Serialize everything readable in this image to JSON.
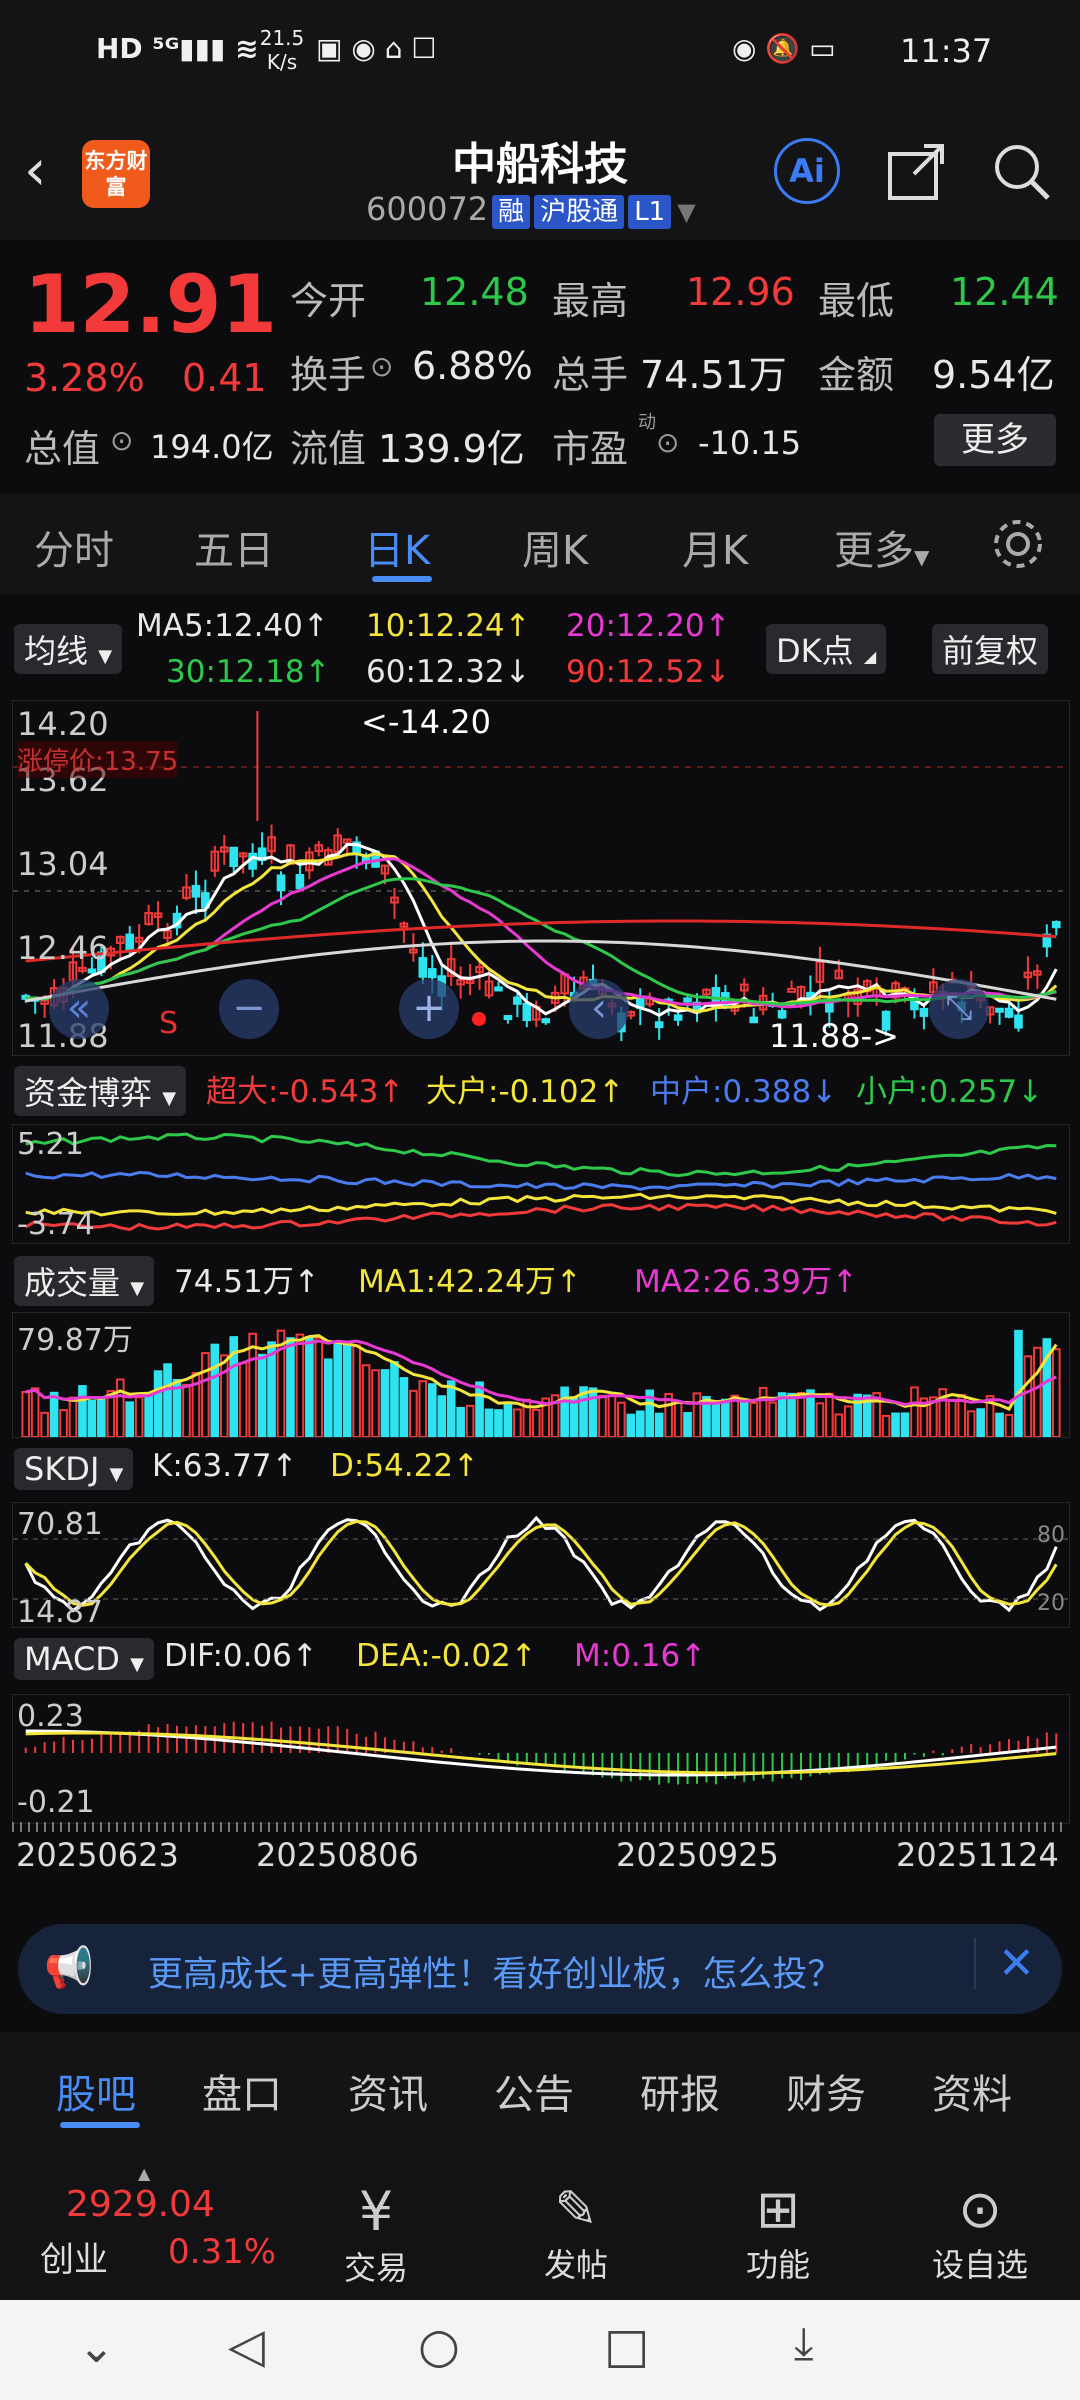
{
  "status": {
    "network_speed": "21.5 K/s",
    "time": "11:37"
  },
  "header": {
    "logo_text": "东方财富",
    "title": "中船科技",
    "code": "600072",
    "tags": [
      "融",
      "沪股通",
      "L1"
    ]
  },
  "quote": {
    "price": "12.91",
    "pct": "3.28%",
    "chg": "0.41",
    "open_label": "今开",
    "open": "12.48",
    "high_label": "最高",
    "high": "12.96",
    "low_label": "最低",
    "low": "12.44",
    "turnover_label": "换手",
    "turnover": "6.88%",
    "volume_label": "总手",
    "volume": "74.51万",
    "amount_label": "金额",
    "amount": "9.54亿",
    "mktcap_label": "总值",
    "mktcap": "194.0亿",
    "float_label": "流值",
    "float": "139.9亿",
    "pe_label": "市盈",
    "pe_sup": "动",
    "pe": "-10.15",
    "more": "更多"
  },
  "tabs": [
    "分时",
    "五日",
    "日K",
    "周K",
    "月K",
    "更多"
  ],
  "ma": {
    "selector": "均线",
    "ma5": "MA5:12.40↑",
    "ma10": "10:12.24↑",
    "ma20": "20:12.20↑",
    "ma30": "30:12.18↑",
    "ma60": "60:12.32↓",
    "ma90": "90:12.52↓",
    "dk": "DK点",
    "adjust": "前复权"
  },
  "kchart": {
    "y1": "14.20",
    "y2": "13.62",
    "y3": "13.04",
    "y4": "12.46",
    "y5": "11.88",
    "limit": "涨停价:13.75",
    "max_label": "<-14.20",
    "min_label": "11.88->"
  },
  "funds": {
    "selector": "资金博弈",
    "super": "超大:-0.543↑",
    "large": "大户:-0.102↑",
    "medium": "中户:0.388↓",
    "small": "小户:0.257↓",
    "ytop": "5.21",
    "ybot": "-3.74"
  },
  "volume": {
    "selector": "成交量",
    "val": "74.51万↑",
    "ma1": "MA1:42.24万↑",
    "ma2": "MA2:26.39万↑",
    "ytop": "79.87万"
  },
  "skdj": {
    "selector": "SKDJ",
    "k": "K:63.77↑",
    "d": "D:54.22↑",
    "ytop": "70.81",
    "ybot": "14.87",
    "r80": "80",
    "r20": "20"
  },
  "macd": {
    "selector": "MACD",
    "dif": "DIF:0.06↑",
    "dea": "DEA:-0.02↑",
    "m": "M:0.16↑",
    "ytop": "0.23",
    "ybot": "-0.21"
  },
  "dates": [
    "20250623",
    "20250806",
    "20250925",
    "20251124"
  ],
  "banner": "更高成长+更高弹性！看好创业板，怎么投？",
  "subtabs": [
    "股吧",
    "盘口",
    "资讯",
    "公告",
    "研报",
    "财务",
    "资料"
  ],
  "bottom": {
    "index_val": "2929.04",
    "index_name": "创业",
    "index_pct": "0.31%",
    "trade": "交易",
    "post": "发帖",
    "func": "功能",
    "watch": "设自选"
  }
}
